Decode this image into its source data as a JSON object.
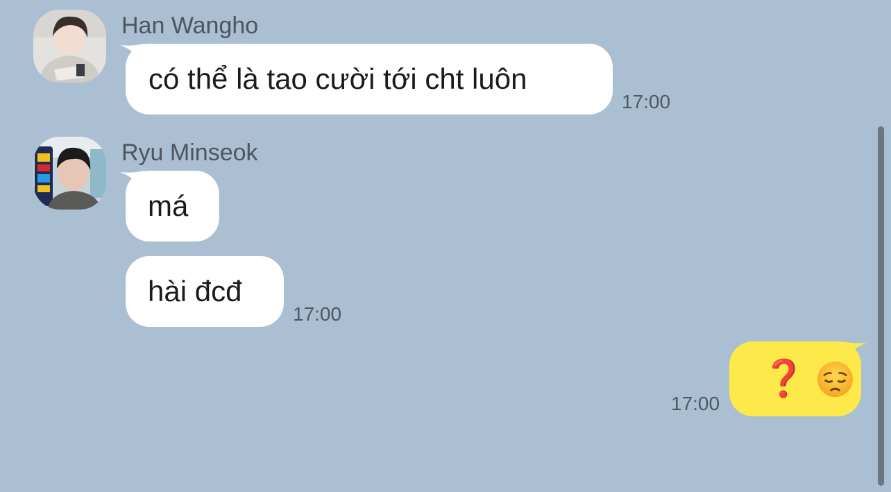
{
  "messages": [
    {
      "sender": "Han Wangho",
      "avatar_icon": "han-wangho-avatar",
      "bubbles": [
        "có thể là tao cười tới cht luôn"
      ],
      "time": "17:00"
    },
    {
      "sender": "Ryu Minseok",
      "avatar_icon": "ryu-minseok-avatar",
      "bubbles": [
        "má",
        "hài đcđ"
      ],
      "time": "17:00"
    }
  ],
  "my_message": {
    "text": "❓",
    "emoji_icon": "pensive-face-emoji",
    "time": "17:00"
  },
  "colors": {
    "background": "#aabfd2",
    "incoming_bubble": "#ffffff",
    "outgoing_bubble": "#fee94b"
  }
}
